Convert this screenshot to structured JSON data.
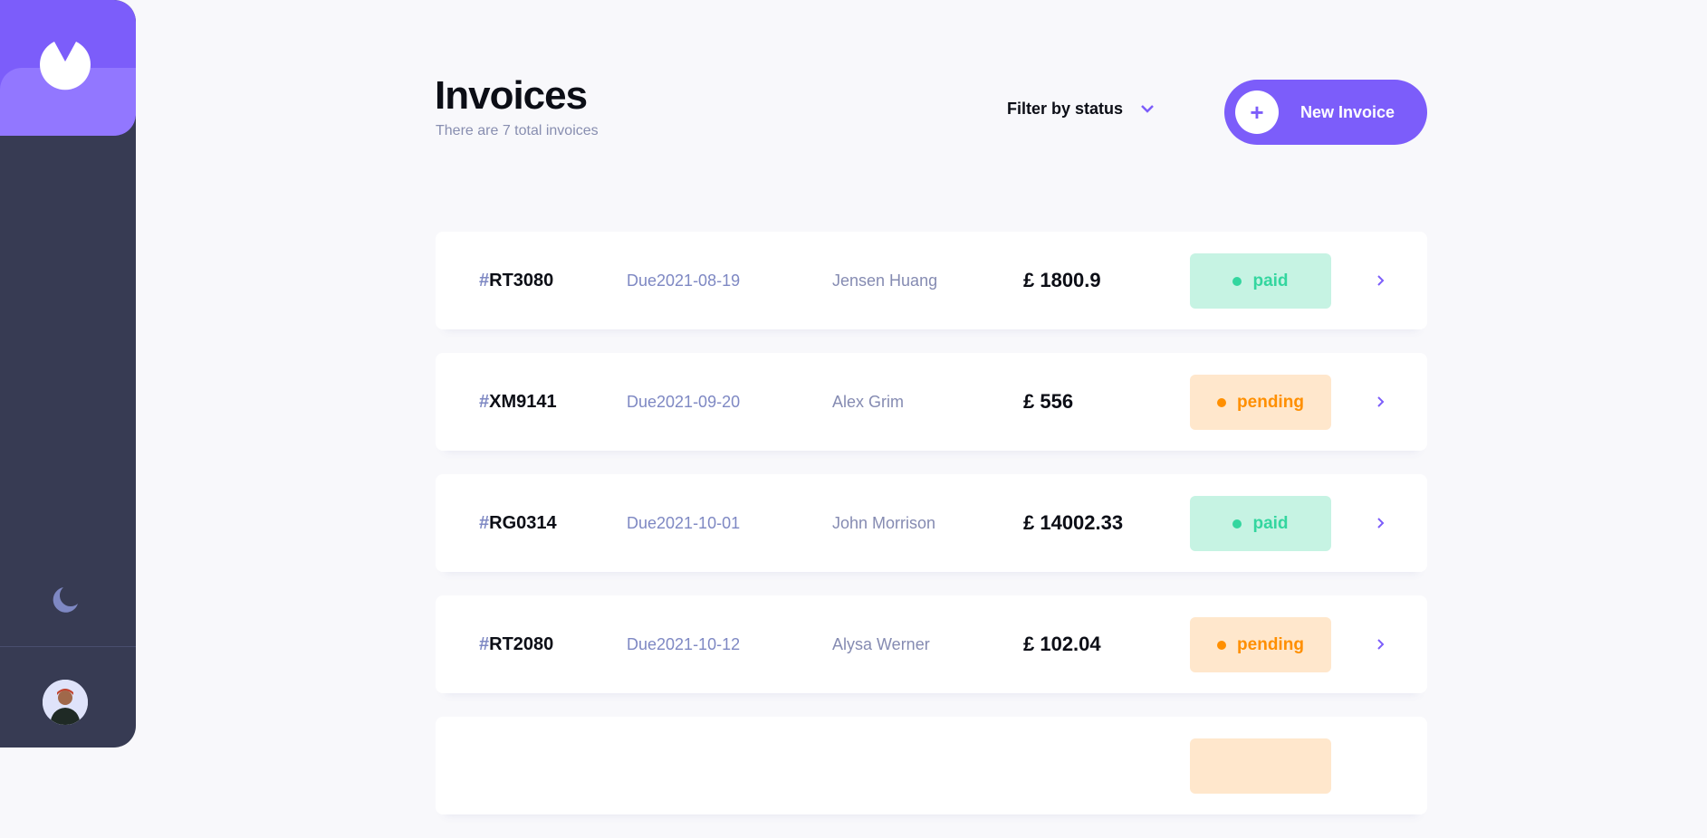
{
  "header": {
    "title": "Invoices",
    "subtitle": "There are 7 total invoices",
    "filter_label": "Filter by status",
    "new_invoice_label": "New Invoice",
    "plus_symbol": "+"
  },
  "sidebar": {
    "logo_icon": "logo-icon",
    "theme_icon": "moon-icon",
    "avatar": "user-avatar"
  },
  "colors": {
    "accent": "#7c5dfa",
    "sidebar": "#373b53",
    "paid": "#33d69f",
    "pending": "#ff8f00"
  },
  "invoices": [
    {
      "hash": "#",
      "id": "RT3080",
      "due": "Due2021-08-19",
      "client": "Jensen Huang",
      "amount": "£ 1800.9",
      "status": "paid"
    },
    {
      "hash": "#",
      "id": "XM9141",
      "due": "Due2021-09-20",
      "client": "Alex Grim",
      "amount": "£ 556",
      "status": "pending"
    },
    {
      "hash": "#",
      "id": "RG0314",
      "due": "Due2021-10-01",
      "client": "John Morrison",
      "amount": "£ 14002.33",
      "status": "paid"
    },
    {
      "hash": "#",
      "id": "RT2080",
      "due": "Due2021-10-12",
      "client": "Alysa Werner",
      "amount": "£ 102.04",
      "status": "pending"
    },
    {
      "hash": "",
      "id": "",
      "due": "",
      "client": "",
      "amount": "",
      "status": "pending"
    }
  ]
}
